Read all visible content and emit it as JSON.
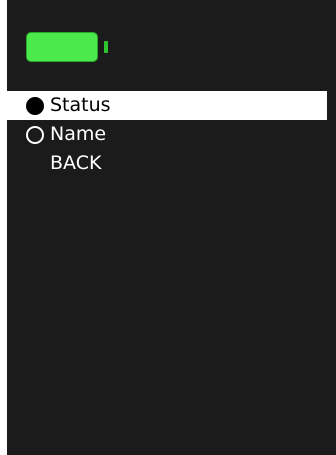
{
  "battery": {
    "icon": "battery-full-icon",
    "level": 1.0,
    "fill_color": "#4ce94c"
  },
  "menu": {
    "items": [
      {
        "label": "Status",
        "radio": "filled",
        "selected": true
      },
      {
        "label": "Name",
        "radio": "empty",
        "selected": false
      },
      {
        "label": "BACK",
        "radio": "none",
        "selected": false
      }
    ]
  },
  "colors": {
    "background": "#1b1b1b",
    "highlight": "#ffffff",
    "text": "#ffffff"
  }
}
